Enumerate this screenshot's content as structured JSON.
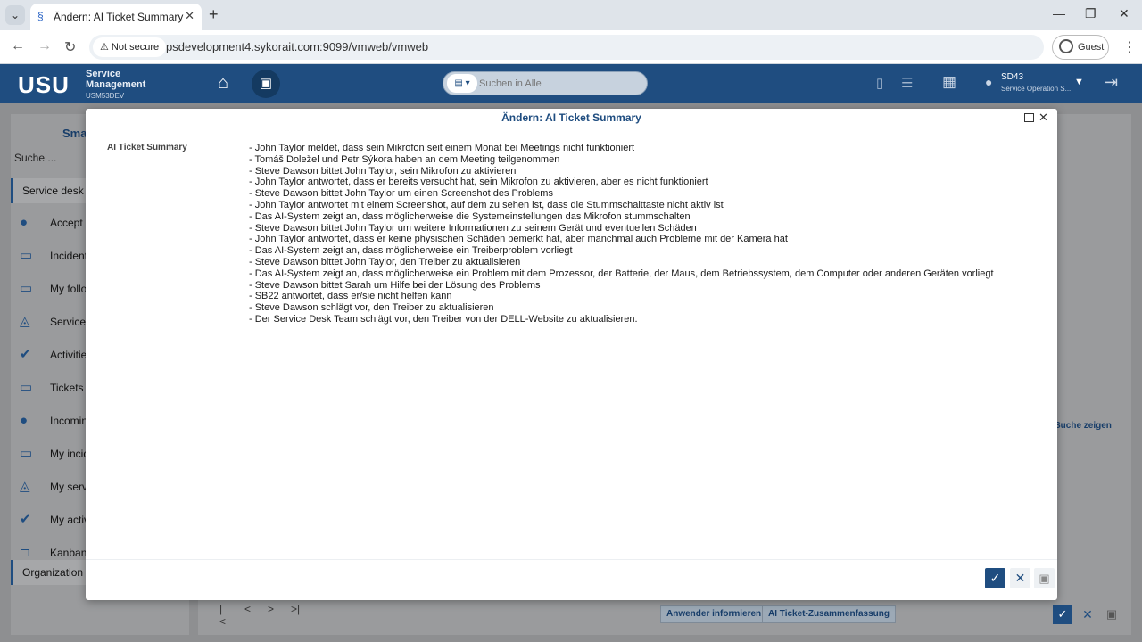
{
  "browser": {
    "tab_title": "Ändern: AI Ticket Summary",
    "not_secure_label": "Not secure",
    "url": "psdevelopment4.sykorait.com:9099/vmweb/vmweb",
    "profile_label": "Guest"
  },
  "app": {
    "logo": "USU",
    "product_line1": "Service",
    "product_line2": "Management",
    "environment": "USM53DEV",
    "search_placeholder": "Suchen in Alle",
    "user_name": "SD43",
    "user_role": "Service Operation S..."
  },
  "sidebar": {
    "title": "Sma",
    "search_label": "Suche ...",
    "section_top": "Service desk",
    "section_bottom": "Organization",
    "items": [
      {
        "label": "Accept",
        "icon": "users-icon"
      },
      {
        "label": "Incident",
        "icon": "ticket-icon"
      },
      {
        "label": "My follo",
        "icon": "ticket-icon"
      },
      {
        "label": "Service",
        "icon": "service-icon"
      },
      {
        "label": "Activitie",
        "icon": "check-icon"
      },
      {
        "label": "Tickets",
        "icon": "ticket-icon"
      },
      {
        "label": "Incomin",
        "icon": "users-icon"
      },
      {
        "label": "My incid",
        "icon": "ticket-icon"
      },
      {
        "label": "My serv",
        "icon": "service-icon"
      },
      {
        "label": "My activ",
        "icon": "check-icon"
      },
      {
        "label": "Kanban",
        "icon": "kanban-icon"
      }
    ]
  },
  "background": {
    "suche_zeigen": "Suche zeigen",
    "btn_inform": "Anwender informieren",
    "btn_summary": "AI Ticket-Zusammenfassung"
  },
  "dialog": {
    "title": "Ändern: AI Ticket Summary",
    "field_label": "AI Ticket Summary",
    "lines": [
      "- John Taylor meldet, dass sein Mikrofon seit einem Monat bei Meetings nicht funktioniert",
      "- Tomáš Doležel und Petr Sýkora haben an dem Meeting teilgenommen",
      "- Steve Dawson bittet John Taylor, sein Mikrofon zu aktivieren",
      "- John Taylor antwortet, dass er bereits versucht hat, sein Mikrofon zu aktivieren, aber es nicht funktioniert",
      "- Steve Dawson bittet John Taylor um einen Screenshot des Problems",
      "- John Taylor antwortet mit einem Screenshot, auf dem zu sehen ist, dass die Stummschalttaste nicht aktiv ist",
      "- Das AI-System zeigt an, dass möglicherweise die Systemeinstellungen das Mikrofon stummschalten",
      "- Steve Dawson bittet John Taylor um weitere Informationen zu seinem Gerät und eventuellen Schäden",
      "- John Taylor antwortet, dass er keine physischen Schäden bemerkt hat, aber manchmal auch Probleme mit der Kamera hat",
      "- Das AI-System zeigt an, dass möglicherweise ein Treiberproblem vorliegt",
      "- Steve Dawson bittet John Taylor, den Treiber zu aktualisieren",
      "- Das AI-System zeigt an, dass möglicherweise ein Problem mit dem Prozessor, der Batterie, der Maus, dem Betriebssystem, dem Computer oder anderen Geräten vorliegt",
      "- Steve Dawson bittet Sarah um Hilfe bei der Lösung des Problems",
      "- SB22 antwortet, dass er/sie nicht helfen kann",
      "- Steve Dawson schlägt vor, den Treiber zu aktualisieren",
      "- Der Service Desk Team schlägt vor, den Treiber von der DELL-Website zu aktualisieren."
    ]
  },
  "colors": {
    "brand": "#1f4d80",
    "overlay": "#8e8f91"
  }
}
